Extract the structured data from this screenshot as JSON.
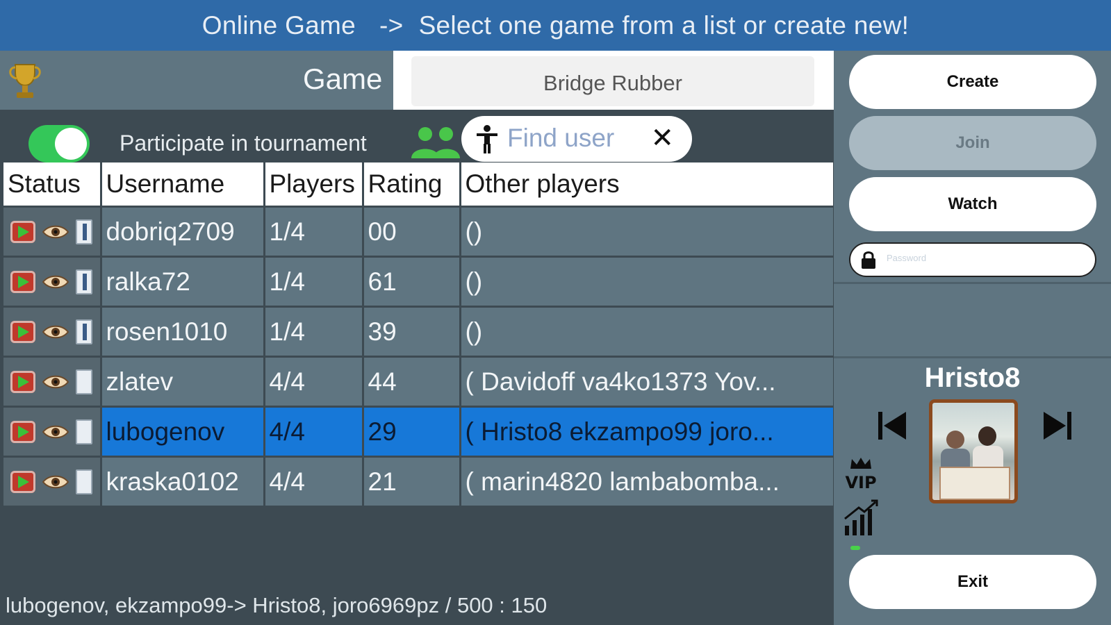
{
  "header": {
    "title": "Online Game",
    "arrow": "->",
    "subtitle": "Select one game from a list or create new!"
  },
  "game": {
    "label": "Game",
    "selected": "Bridge Rubber"
  },
  "tournament": {
    "label": "Participate in tournament",
    "enabled": true
  },
  "find_user": {
    "placeholder": "Find user",
    "clear": "✕"
  },
  "table": {
    "columns": [
      "Status",
      "Username",
      "Players",
      "Rating",
      "Other players"
    ],
    "rows": [
      {
        "username": "dobriq2709",
        "players": "1/4",
        "rating": "00",
        "others": "()",
        "selected": false,
        "door": "open"
      },
      {
        "username": "ralka72",
        "players": "1/4",
        "rating": "61",
        "others": "()",
        "selected": false,
        "door": "open"
      },
      {
        "username": "rosen1010",
        "players": "1/4",
        "rating": "39",
        "others": "()",
        "selected": false,
        "door": "open"
      },
      {
        "username": "zlatev",
        "players": "4/4",
        "rating": "44",
        "others": "( Davidoff  va4ko1373  Yov...",
        "selected": false,
        "door": "closed"
      },
      {
        "username": "lubogenov",
        "players": "4/4",
        "rating": "29",
        "others": "( Hristo8  ekzampo99  joro...",
        "selected": true,
        "door": "closed"
      },
      {
        "username": "kraska0102",
        "players": "4/4",
        "rating": "21",
        "others": "( marin4820  lambabomba...",
        "selected": false,
        "door": "closed"
      }
    ]
  },
  "status_line": "lubogenov, ekzampo99-> Hristo8, joro6969pz / 500 : 150",
  "actions": {
    "create": "Create",
    "join": "Join",
    "watch": "Watch",
    "password_placeholder": "Password",
    "exit": "Exit"
  },
  "player": {
    "name": "Hristo8",
    "vip": "VIP"
  },
  "colors": {
    "header": "#2f6aa8",
    "panel": "#5f7581",
    "background": "#3d4a52",
    "selected_row": "#1778d8",
    "toggle_on": "#34c759"
  }
}
